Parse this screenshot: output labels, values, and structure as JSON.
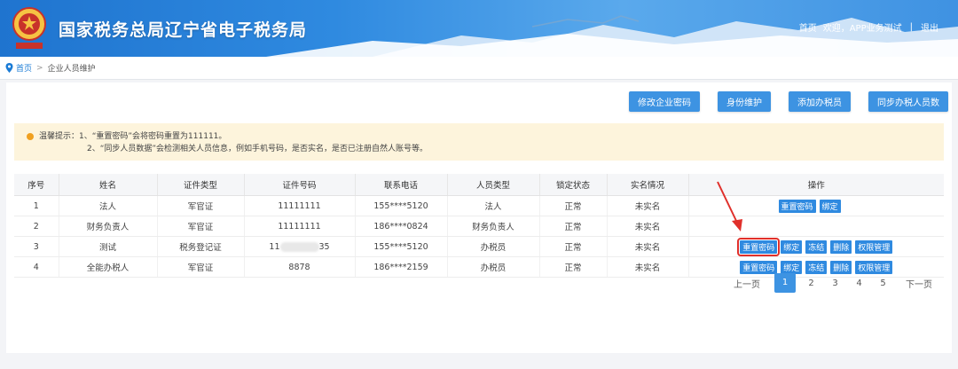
{
  "header": {
    "site_title": "国家税务总局辽宁省电子税务局",
    "nav_home": "首页",
    "nav_welcome": "欢迎，",
    "nav_user": "APP业务测试",
    "nav_separator": "|",
    "nav_logout": "退出"
  },
  "breadcrumb": {
    "home": "首页",
    "separator": ">",
    "current": "企业人员维护"
  },
  "actions": {
    "change_password": "修改企业密码",
    "identity": "身份维护",
    "add_staff": "添加办税员",
    "sync_staff": "同步办税人员数"
  },
  "tips": {
    "line1": "温馨提示：1、“重置密码”会将密码重置为111111。",
    "line2": "2、“同步人员数据”会检测相关人员信息，例如手机号码，是否实名，是否已注册自然人账号等。"
  },
  "table": {
    "headers": [
      "序号",
      "姓名",
      "证件类型",
      "证件号码",
      "联系电话",
      "人员类型",
      "锁定状态",
      "实名情况",
      "操作"
    ],
    "rows": [
      {
        "no": "1",
        "name": "法人",
        "id_type": "军官证",
        "id_no": "11111111",
        "id_no_suffix": "",
        "phone": "155****5120",
        "role": "法人",
        "lock": "正常",
        "realname": "未实名",
        "ops": [
          "重置密码",
          "绑定"
        ]
      },
      {
        "no": "2",
        "name": "财务负责人",
        "id_type": "军官证",
        "id_no": "11111111",
        "id_no_suffix": "",
        "phone": "186****0824",
        "role": "财务负责人",
        "lock": "正常",
        "realname": "未实名",
        "ops": []
      },
      {
        "no": "3",
        "name": "测试",
        "id_type": "税务登记证",
        "id_no": "11",
        "id_no_suffix": "35",
        "phone": "155****5120",
        "role": "办税员",
        "lock": "正常",
        "realname": "未实名",
        "ops": [
          "重置密码",
          "绑定",
          "冻结",
          "删除",
          "权限管理"
        ]
      },
      {
        "no": "4",
        "name": "全能办税人",
        "id_type": "军官证",
        "id_no": "8878",
        "id_no_suffix": "",
        "phone": "186****2159",
        "role": "办税员",
        "lock": "正常",
        "realname": "未实名",
        "ops": [
          "重置密码",
          "绑定",
          "冻结",
          "删除",
          "权限管理"
        ]
      }
    ]
  },
  "pager": {
    "prev": "上一页",
    "pages": [
      "1",
      "2",
      "3",
      "4",
      "5"
    ],
    "current": "1",
    "next": "下一页"
  },
  "colors": {
    "accent": "#3d93e2",
    "highlight": "#e0302b",
    "tips_bg": "#fdf4dc"
  }
}
